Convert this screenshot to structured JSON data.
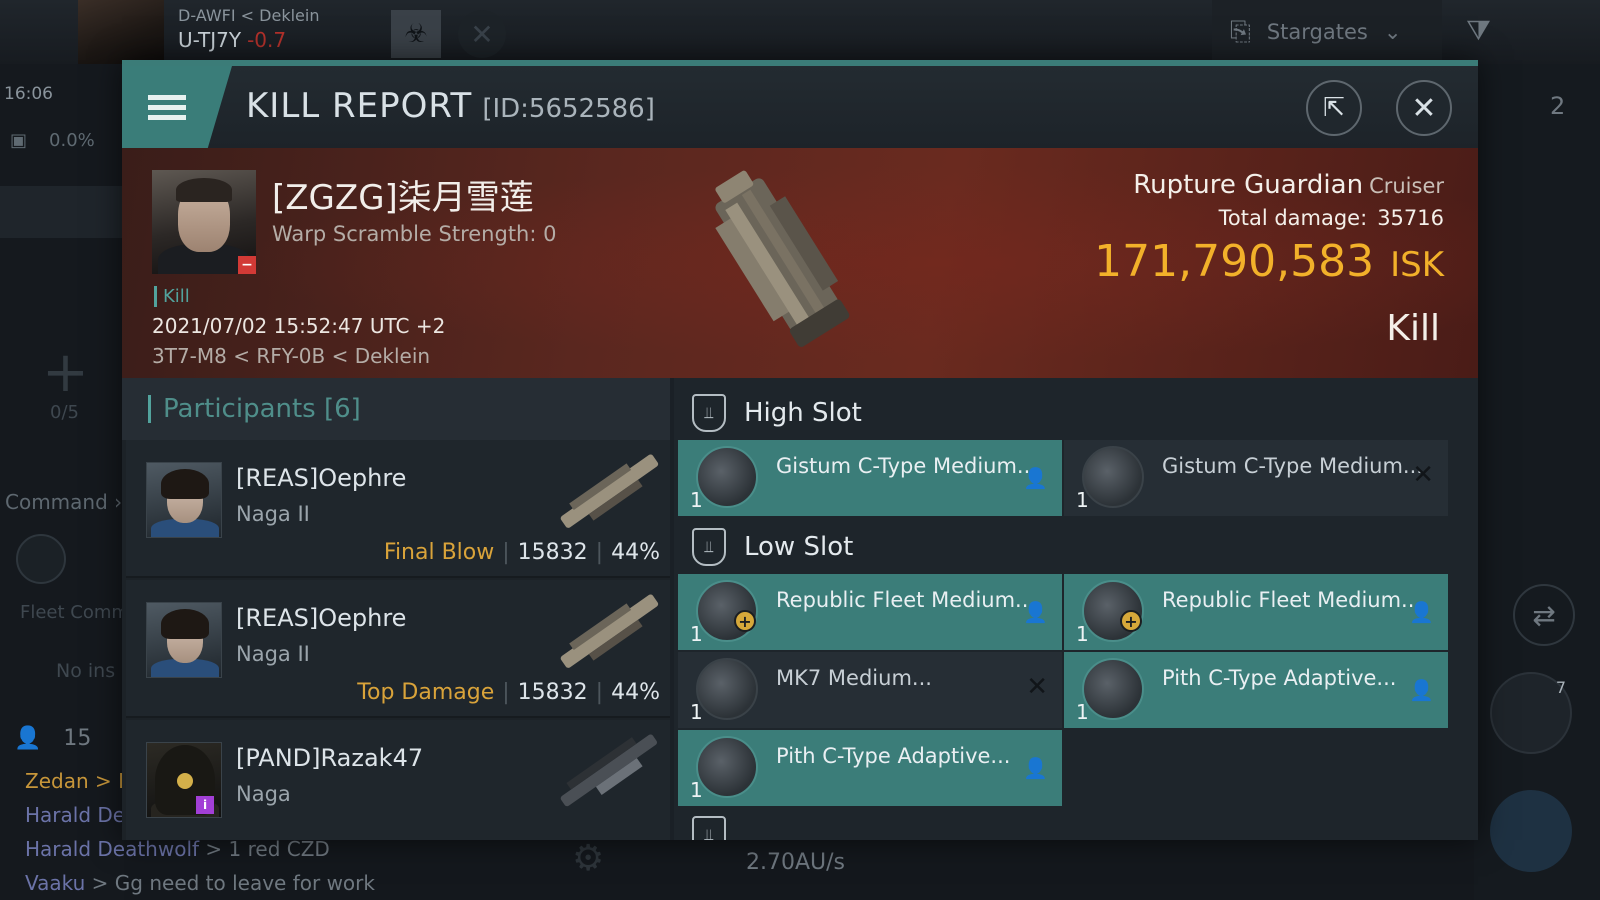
{
  "hud": {
    "region": "D-AWFI",
    "region_separator": "<",
    "constellation": "Deklein",
    "current_system": "U-TJ7Y",
    "security": "-0.7",
    "time": "16:06",
    "cargo_pct": "0.0%",
    "fleet_slots": "0/5",
    "command_label": "Command",
    "fleet_comm_label": "Fleet Comm",
    "no_ins_label": "No ins",
    "users_count": "15",
    "stargates_label": "Stargates",
    "speed": "2.70AU/s",
    "right_count": "2",
    "ship_count": "7",
    "chat": [
      {
        "name": "Zedan",
        "sep": " > K",
        "msg": ""
      },
      {
        "name": "Harald De",
        "sep": "",
        "msg": ""
      },
      {
        "name": "Harald Deathwolf",
        "sep": " > ",
        "msg": "1 red CZD"
      },
      {
        "name": "Vaaku",
        "sep": " > ",
        "msg": "Gg need to leave for work"
      }
    ]
  },
  "report": {
    "title": "KILL REPORT",
    "id": "[ID:5652586]",
    "victim": {
      "name": "[ZGZG]柒月雪莲",
      "warp_scramble": "Warp Scramble Strength: 0",
      "kill_tag": "Kill",
      "datetime": "2021/07/02 15:52:47 UTC +2",
      "location": "3T7-M8 < RFY-0B < Deklein"
    },
    "ship": {
      "name": "Rupture Guardian",
      "class": "Cruiser",
      "damage_label": "Total damage:",
      "damage": "35716",
      "isk": "171,790,583",
      "isk_unit": "ISK",
      "status": "Kill"
    },
    "participants": {
      "label": "Participants",
      "count": "[6]",
      "rows": [
        {
          "name": "[REAS]Oephre",
          "ship": "Naga II",
          "tag": "Final Blow",
          "damage": "15832",
          "pct": "44%"
        },
        {
          "name": "[REAS]Oephre",
          "ship": "Naga II",
          "tag": "Top Damage",
          "damage": "15832",
          "pct": "44%"
        },
        {
          "name": "[PAND]Razak47",
          "ship": "Naga",
          "tag": "",
          "damage": "",
          "pct": ""
        }
      ]
    },
    "fitting": {
      "high_label": "High Slot",
      "low_label": "Low Slot",
      "high": [
        {
          "name": "Gistum C-Type Medium...",
          "qty": "1",
          "state": "person-icon"
        },
        {
          "name": "Gistum C-Type Medium...",
          "qty": "1",
          "state": "x-icon"
        }
      ],
      "low": [
        {
          "name": "Republic Fleet Medium...",
          "qty": "1",
          "state": "person-icon"
        },
        {
          "name": "Republic Fleet Medium...",
          "qty": "1",
          "state": "person-icon"
        },
        {
          "name": "MK7 Medium...",
          "qty": "1",
          "state": "x-icon"
        },
        {
          "name": "Pith C-Type Adaptive...",
          "qty": "1",
          "state": "person-icon"
        },
        {
          "name": "Pith C-Type Adaptive...",
          "qty": "1",
          "state": "person-icon"
        }
      ]
    }
  }
}
